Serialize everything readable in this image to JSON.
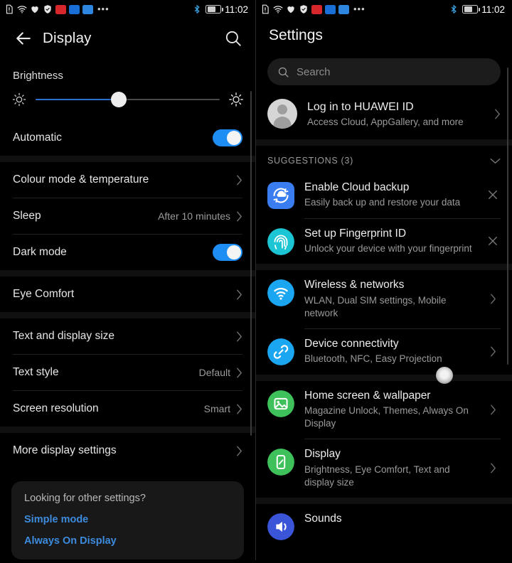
{
  "status_bar": {
    "icons": [
      "sim-alert-icon",
      "wifi-icon",
      "health-icon",
      "shield-icon",
      "red-app-icon",
      "blue-app-icon",
      "lightblue-app-icon",
      "more-dots-icon"
    ],
    "more_dots": "•••",
    "bluetooth_icon": "bluetooth-icon",
    "battery_icon": "battery-charging-icon",
    "time": "11:02"
  },
  "left_panel": {
    "header": {
      "back_icon": "back-arrow-icon",
      "title": "Display",
      "search_icon": "search-icon"
    },
    "brightness": {
      "label": "Brightness",
      "low_icon": "brightness-low-icon",
      "high_icon": "brightness-high-icon",
      "value_percent": 45
    },
    "automatic": {
      "label": "Automatic",
      "enabled": true
    },
    "rows_group_1": [
      {
        "label": "Colour mode & temperature",
        "value": "",
        "chevron": true
      },
      {
        "label": "Sleep",
        "value": "After 10 minutes",
        "chevron": true
      }
    ],
    "dark_mode": {
      "label": "Dark mode",
      "enabled": true
    },
    "rows_group_2": [
      {
        "label": "Eye Comfort",
        "value": "",
        "chevron": true
      }
    ],
    "rows_group_3": [
      {
        "label": "Text and display size",
        "value": "",
        "chevron": true
      },
      {
        "label": "Text style",
        "value": "Default",
        "chevron": true
      },
      {
        "label": "Screen resolution",
        "value": "Smart",
        "chevron": true
      }
    ],
    "rows_group_4": [
      {
        "label": "More display settings",
        "value": "",
        "chevron": true
      }
    ],
    "other_settings_card": {
      "question": "Looking for other settings?",
      "links": [
        "Simple mode",
        "Always On Display"
      ]
    }
  },
  "right_panel": {
    "title": "Settings",
    "search": {
      "placeholder": "Search",
      "icon": "search-icon"
    },
    "account": {
      "avatar_icon": "user-avatar-icon",
      "title": "Log in to HUAWEI ID",
      "subtitle": "Access Cloud, AppGallery, and more",
      "chevron": "chevron-right-icon"
    },
    "suggestions_header": {
      "label": "SUGGESTIONS (3)",
      "collapse_icon": "chevron-down-icon"
    },
    "suggestions": [
      {
        "icon": "cloud-backup-icon",
        "icon_color": "#3a7df0",
        "icon_shape": "square",
        "title": "Enable Cloud backup",
        "subtitle": "Easily back up and restore your data",
        "action_icon": "close-icon"
      },
      {
        "icon": "fingerprint-icon",
        "icon_color": "#1cc5d4",
        "icon_shape": "circle",
        "title": "Set up Fingerprint ID",
        "subtitle": "Unlock your device with your fingerprint",
        "action_icon": "close-icon"
      }
    ],
    "settings_items": [
      {
        "icon": "wifi-icon",
        "icon_color": "#1aa6f0",
        "icon_shape": "circle",
        "title": "Wireless & networks",
        "subtitle": "WLAN, Dual SIM settings, Mobile network",
        "action_icon": "chevron-right-icon"
      },
      {
        "icon": "link-icon",
        "icon_color": "#1aa6f0",
        "icon_shape": "circle",
        "title": "Device connectivity",
        "subtitle": "Bluetooth, NFC, Easy Projection",
        "action_icon": "chevron-right-icon"
      },
      {
        "icon": "image-icon",
        "icon_color": "#3ec05a",
        "icon_shape": "circle",
        "title": "Home screen & wallpaper",
        "subtitle": "Magazine Unlock, Themes, Always On Display",
        "action_icon": "chevron-right-icon"
      },
      {
        "icon": "phone-display-icon",
        "icon_color": "#3ec05a",
        "icon_shape": "circle",
        "title": "Display",
        "subtitle": "Brightness, Eye Comfort, Text and display size",
        "action_icon": "chevron-right-icon"
      }
    ],
    "partial_item": {
      "icon": "sound-icon",
      "icon_color": "#3b55d9",
      "title": "Sounds"
    }
  }
}
